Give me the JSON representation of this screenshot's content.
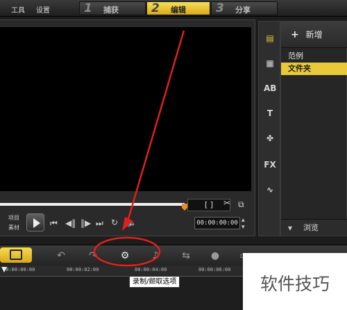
{
  "menu": {
    "tools": "工具",
    "settings": "设置"
  },
  "steps": [
    {
      "num": "1",
      "label": "捕获"
    },
    {
      "num": "2",
      "label": "编辑"
    },
    {
      "num": "3",
      "label": "分享"
    }
  ],
  "player": {
    "mode_label_top": "项目",
    "mode_label_bottom": "素材",
    "timecode": "00:00:00:00",
    "trim_brackets": "[   ]"
  },
  "library": {
    "add_label": "新增",
    "items": [
      "范例",
      "文件夹"
    ],
    "selected_index": 1,
    "browse_label": "浏览"
  },
  "timeline": {
    "ruler_ticks": [
      "00:00:00:00",
      "00:00:02:00",
      "00:00:04:00",
      "00:00:06:00"
    ],
    "tooltip": "录制/撷取选项"
  },
  "watermark": "软件技巧",
  "colors": {
    "accent": "#e7c93a",
    "annotation": "#e02020",
    "scrub_handle": "#f08a1c"
  }
}
